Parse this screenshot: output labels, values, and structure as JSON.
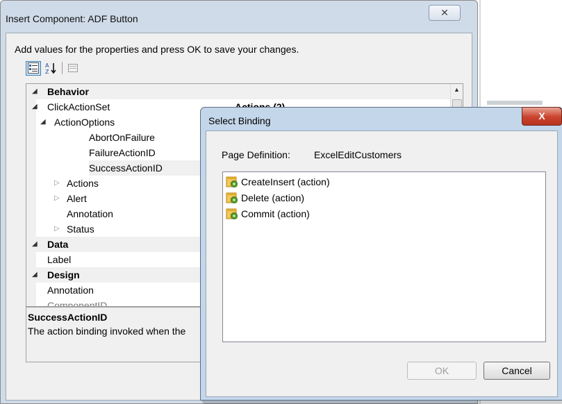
{
  "main_dialog": {
    "title": "Insert Component: ADF Button",
    "close_glyph": "✕",
    "instructions": "Add values for the properties and press OK to save your changes.",
    "toolbar": {
      "categorized_icon": "categorized-view-icon",
      "sort_icon": "sort-alphabetical-icon",
      "pages_icon": "property-pages-icon"
    },
    "grid_value_partial": "Actions (2)",
    "grid_rows": [
      {
        "label": "Behavior",
        "kind": "category",
        "expander": "open"
      },
      {
        "label": "ClickActionSet",
        "kind": "item",
        "expander": "open"
      },
      {
        "label": "ActionOptions",
        "kind": "item",
        "expander": "open"
      },
      {
        "label": "AbortOnFailure",
        "kind": "item",
        "expander": "none"
      },
      {
        "label": "FailureActionID",
        "kind": "item",
        "expander": "none"
      },
      {
        "label": "SuccessActionID",
        "kind": "item",
        "expander": "none"
      },
      {
        "label": "Actions",
        "kind": "item",
        "expander": "closed"
      },
      {
        "label": "Alert",
        "kind": "item",
        "expander": "closed"
      },
      {
        "label": "Annotation",
        "kind": "item",
        "expander": "none"
      },
      {
        "label": "Status",
        "kind": "item",
        "expander": "closed"
      },
      {
        "label": "Data",
        "kind": "category",
        "expander": "open"
      },
      {
        "label": "Label",
        "kind": "item",
        "expander": "none"
      },
      {
        "label": "Design",
        "kind": "category",
        "expander": "open"
      },
      {
        "label": "Annotation",
        "kind": "item",
        "expander": "none"
      },
      {
        "label": "ComponentID",
        "kind": "item-dim",
        "expander": "none"
      }
    ],
    "description": {
      "title": "SuccessActionID",
      "text": "The action binding invoked when the"
    }
  },
  "select_binding": {
    "title": "Select Binding",
    "close_glyph": "X",
    "page_definition_label": "Page Definition:",
    "page_definition_value": "ExcelEditCustomers",
    "items": [
      {
        "label": "CreateInsert (action)",
        "icon": "action-binding-icon"
      },
      {
        "label": "Delete (action)",
        "icon": "action-binding-icon"
      },
      {
        "label": "Commit (action)",
        "icon": "action-binding-icon"
      }
    ],
    "ok_label": "OK",
    "cancel_label": "Cancel"
  },
  "colors": {
    "frame": "#cfdbe8",
    "child_frame": "#c4d6ea",
    "close_red": "#c9422d",
    "body": "#f0f0f0"
  }
}
